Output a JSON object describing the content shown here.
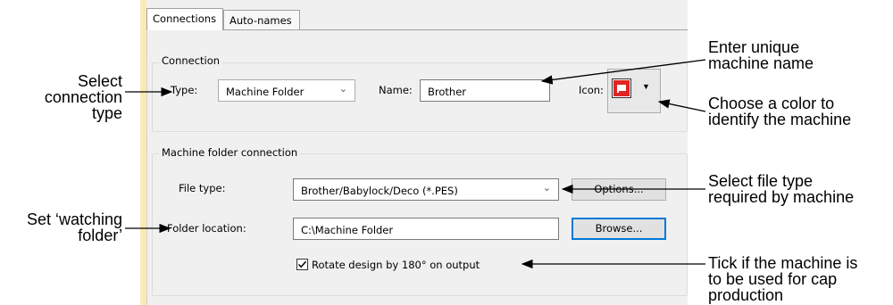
{
  "tabs": [
    {
      "label": "Connections"
    },
    {
      "label": "Auto-names"
    }
  ],
  "connection": {
    "group_label": "Connection",
    "type_label": "Type:",
    "type_value": "Machine Folder",
    "name_label": "Name:",
    "name_value": "Brother",
    "icon_label": "Icon:",
    "icon_color": "#e02424"
  },
  "machine_folder": {
    "group_label": "Machine folder connection",
    "file_type_label": "File type:",
    "file_type_value": "Brother/Babylock/Deco (*.PES)",
    "options_button": "Options...",
    "folder_label": "Folder location:",
    "folder_value": "C:\\Machine Folder",
    "browse_button": "Browse...",
    "rotate_label": "Rotate design by 180° on output",
    "rotate_checked": true
  },
  "annotations": {
    "select_connection_type": [
      "Select",
      "connection",
      "type"
    ],
    "set_watching_folder": [
      "Set ‘watching",
      "folder’"
    ],
    "enter_name": [
      "Enter unique",
      "machine name"
    ],
    "choose_color": [
      "Choose a color to",
      "identify the machine"
    ],
    "select_file_type": [
      "Select file type",
      "required by machine"
    ],
    "tick_cap": [
      "Tick if the machine is",
      "to be used for cap",
      "production"
    ]
  }
}
